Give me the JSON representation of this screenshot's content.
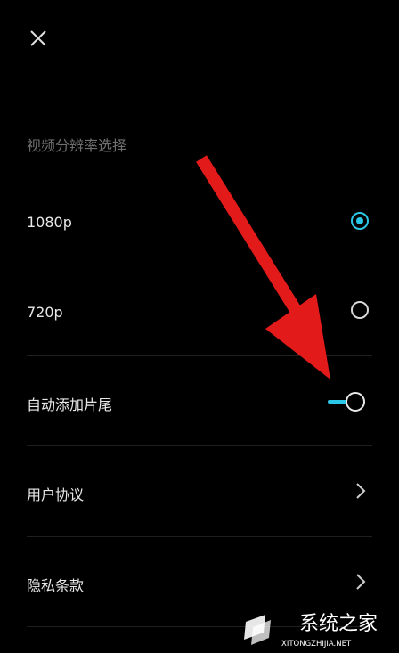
{
  "header": {
    "close_icon": "close-icon"
  },
  "resolution": {
    "title": "视频分辨率选择",
    "options": [
      {
        "label": "1080p",
        "selected": true
      },
      {
        "label": "720p",
        "selected": false
      }
    ]
  },
  "settings": {
    "auto_end": {
      "label": "自动添加片尾",
      "enabled": true
    },
    "user_agreement": {
      "label": "用户协议"
    },
    "privacy": {
      "label": "隐私条款"
    }
  },
  "watermark": {
    "name": "系统之家",
    "domain": "XITONGZHIJIA.NET"
  },
  "colors": {
    "accent": "#2bc7e6",
    "arrow": "#e31a1a",
    "background": "#000000"
  }
}
